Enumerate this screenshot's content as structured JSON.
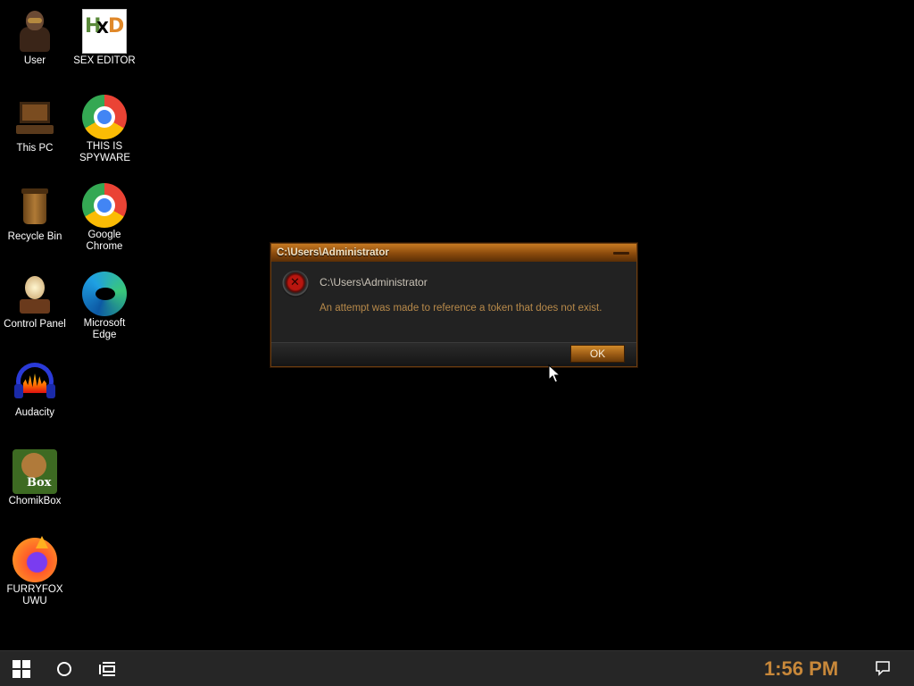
{
  "desktop": {
    "icons": [
      {
        "label": "User"
      },
      {
        "label": "SEX EDITOR"
      },
      {
        "label": "This PC"
      },
      {
        "label": "THIS IS SPYWARE"
      },
      {
        "label": "Recycle Bin"
      },
      {
        "label": "Google Chrome"
      },
      {
        "label": "Control Panel"
      },
      {
        "label": "Microsoft Edge"
      },
      {
        "label": "Audacity"
      },
      {
        "label": "ChomikBox"
      },
      {
        "label": "FURRYFOX UWU"
      }
    ],
    "hxd_logo": {
      "h": "H",
      "x": "X",
      "d": "D"
    },
    "chomik_logo": "Box"
  },
  "dialog": {
    "title": "C:\\Users\\Administrator",
    "heading": "C:\\Users\\Administrator",
    "message": "An attempt was made to reference a token that does not exist.",
    "ok_label": "OK",
    "icon": "error-icon"
  },
  "taskbar": {
    "start_icon": "windows-logo-icon",
    "search_icon": "search-circle-icon",
    "taskview_icon": "task-view-icon",
    "clock": "1:56 PM",
    "notification_icon": "action-center-icon",
    "clock_color": "#c8883a"
  },
  "theme": {
    "accent": "#c77a22",
    "background": "#000000"
  }
}
